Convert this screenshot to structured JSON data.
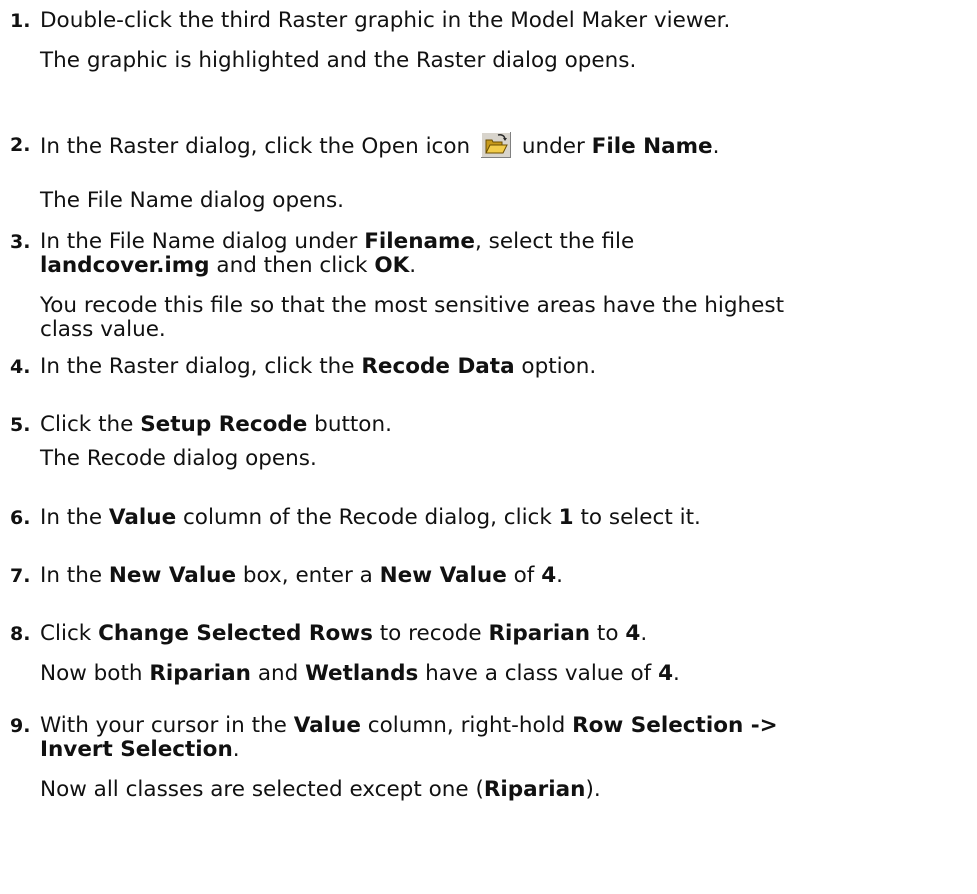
{
  "steps": [
    {
      "num": "1.",
      "lines": [
        {
          "type": "instruction",
          "parts": [
            {
              "t": "Double-click the third Raster graphic in the Model Maker viewer."
            }
          ]
        },
        {
          "type": "result",
          "parts": [
            {
              "t": "The graphic is highlighted and the Raster dialog opens."
            }
          ]
        }
      ]
    },
    {
      "num": "2.",
      "lines": [
        {
          "type": "instruction",
          "parts": [
            {
              "t": "In the Raster dialog, click the Open icon "
            },
            {
              "icon": "open-folder-icon"
            },
            {
              "t": " under "
            },
            {
              "t": "File Name",
              "b": true
            },
            {
              "t": "."
            }
          ]
        },
        {
          "type": "result",
          "parts": [
            {
              "t": "The File Name dialog opens."
            }
          ]
        }
      ]
    },
    {
      "num": "3.",
      "lines": [
        {
          "type": "instruction",
          "parts": [
            {
              "t": "In the File Name dialog under "
            },
            {
              "t": "Filename",
              "b": true
            },
            {
              "t": ", select the file"
            }
          ]
        },
        {
          "type": "instruction-cont",
          "parts": [
            {
              "t": "landcover.img",
              "b": true
            },
            {
              "t": " and then click "
            },
            {
              "t": "OK",
              "b": true
            },
            {
              "t": "."
            }
          ]
        },
        {
          "type": "result",
          "parts": [
            {
              "t": "You recode this file so that the most sensitive areas have the highest"
            }
          ]
        },
        {
          "type": "result-cont",
          "parts": [
            {
              "t": "class value."
            }
          ]
        }
      ]
    },
    {
      "num": "4.",
      "lines": [
        {
          "type": "instruction",
          "parts": [
            {
              "t": "In the Raster dialog, click the "
            },
            {
              "t": "Recode Data",
              "b": true
            },
            {
              "t": " option."
            }
          ]
        }
      ]
    },
    {
      "num": "5.",
      "lines": [
        {
          "type": "instruction",
          "parts": [
            {
              "t": "Click the "
            },
            {
              "t": "Setup Recode",
              "b": true
            },
            {
              "t": " button."
            }
          ]
        },
        {
          "type": "result",
          "parts": [
            {
              "t": "The Recode dialog opens."
            }
          ]
        }
      ]
    },
    {
      "num": "6.",
      "lines": [
        {
          "type": "instruction",
          "parts": [
            {
              "t": "In the "
            },
            {
              "t": "Value",
              "b": true
            },
            {
              "t": " column of the Recode dialog, click "
            },
            {
              "t": "1",
              "b": true
            },
            {
              "t": " to select it."
            }
          ]
        }
      ]
    },
    {
      "num": "7.",
      "lines": [
        {
          "type": "instruction",
          "parts": [
            {
              "t": "In the "
            },
            {
              "t": "New Value",
              "b": true
            },
            {
              "t": " box, enter a "
            },
            {
              "t": "New Value",
              "b": true
            },
            {
              "t": " of "
            },
            {
              "t": "4",
              "b": true
            },
            {
              "t": "."
            }
          ]
        }
      ]
    },
    {
      "num": "8.",
      "lines": [
        {
          "type": "instruction",
          "parts": [
            {
              "t": "Click "
            },
            {
              "t": "Change Selected Rows",
              "b": true
            },
            {
              "t": " to recode "
            },
            {
              "t": "Riparian",
              "b": true
            },
            {
              "t": " to "
            },
            {
              "t": "4",
              "b": true
            },
            {
              "t": "."
            }
          ]
        },
        {
          "type": "result",
          "parts": [
            {
              "t": "Now both "
            },
            {
              "t": "Riparian",
              "b": true
            },
            {
              "t": " and "
            },
            {
              "t": "Wetlands",
              "b": true
            },
            {
              "t": " have a class value of "
            },
            {
              "t": "4",
              "b": true
            },
            {
              "t": "."
            }
          ]
        }
      ]
    },
    {
      "num": "9.",
      "lines": [
        {
          "type": "instruction",
          "parts": [
            {
              "t": "With your cursor in the "
            },
            {
              "t": "Value",
              "b": true
            },
            {
              "t": " column, right-hold "
            },
            {
              "t": "Row Selection ->",
              "b": true
            }
          ]
        },
        {
          "type": "instruction-cont",
          "parts": [
            {
              "t": "Invert Selection",
              "b": true
            },
            {
              "t": "."
            }
          ]
        },
        {
          "type": "result",
          "parts": [
            {
              "t": "Now all classes are selected except one ("
            },
            {
              "t": "Riparian",
              "b": true
            },
            {
              "t": ")."
            }
          ]
        }
      ]
    }
  ]
}
